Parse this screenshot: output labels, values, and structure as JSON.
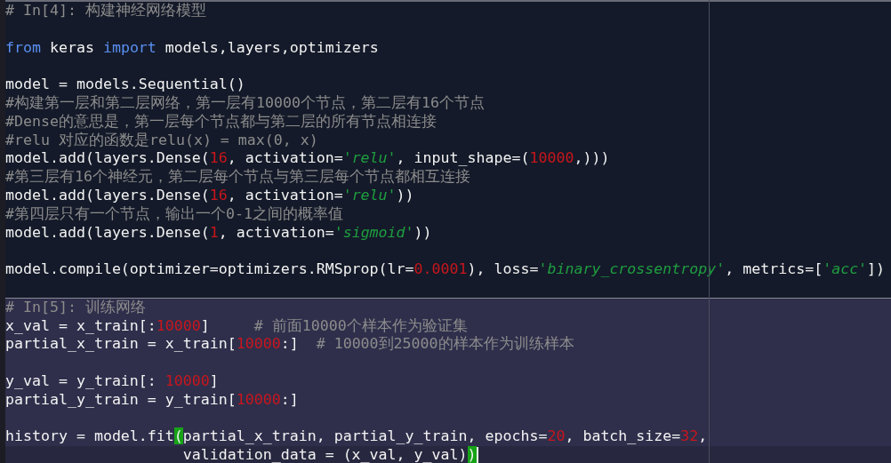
{
  "cells": [
    {
      "selected": false,
      "lines": [
        {
          "current": false,
          "kind": "comment",
          "tokens": [
            {
              "kind": "comment",
              "text": "# In[4]: 构建神经网络模型"
            }
          ]
        },
        {
          "kind": "blank"
        },
        {
          "current": false,
          "kind": "code",
          "tokens": [
            {
              "kind": "keyword",
              "text": "from"
            },
            {
              "kind": "plain",
              "text": " keras "
            },
            {
              "kind": "keyword",
              "text": "import"
            },
            {
              "kind": "plain",
              "text": " models,layers,optimizers"
            }
          ]
        },
        {
          "kind": "blank"
        },
        {
          "current": false,
          "kind": "code",
          "tokens": [
            {
              "kind": "plain",
              "text": "model = models.Sequential()"
            }
          ]
        },
        {
          "current": false,
          "kind": "comment",
          "tokens": [
            {
              "kind": "comment",
              "text": "#构建第一层和第二层网络，第一层有10000个节点，第二层有16个节点"
            }
          ]
        },
        {
          "current": false,
          "kind": "comment",
          "tokens": [
            {
              "kind": "comment",
              "text": "#Dense的意思是，第一层每个节点都与第二层的所有节点相连接"
            }
          ]
        },
        {
          "current": false,
          "kind": "comment",
          "tokens": [
            {
              "kind": "comment",
              "text": "#relu 对应的函数是relu(x) = max(0, x)"
            }
          ]
        },
        {
          "current": false,
          "kind": "code",
          "tokens": [
            {
              "kind": "plain",
              "text": "model.add(layers.Dense("
            },
            {
              "kind": "number",
              "text": "16"
            },
            {
              "kind": "plain",
              "text": ", activation="
            },
            {
              "kind": "string",
              "text": "'relu'"
            },
            {
              "kind": "plain",
              "text": ", input_shape=("
            },
            {
              "kind": "number",
              "text": "10000"
            },
            {
              "kind": "plain",
              "text": ",)))"
            }
          ]
        },
        {
          "current": false,
          "kind": "comment",
          "tokens": [
            {
              "kind": "comment",
              "text": "#第三层有16个神经元，第二层每个节点与第三层每个节点都相互连接"
            }
          ]
        },
        {
          "current": false,
          "kind": "code",
          "tokens": [
            {
              "kind": "plain",
              "text": "model.add(layers.Dense("
            },
            {
              "kind": "number",
              "text": "16"
            },
            {
              "kind": "plain",
              "text": ", activation="
            },
            {
              "kind": "string",
              "text": "'relu'"
            },
            {
              "kind": "plain",
              "text": "))"
            }
          ]
        },
        {
          "current": false,
          "kind": "comment",
          "tokens": [
            {
              "kind": "comment",
              "text": "#第四层只有一个节点，输出一个0-1之间的概率值"
            }
          ]
        },
        {
          "current": false,
          "kind": "code",
          "tokens": [
            {
              "kind": "plain",
              "text": "model.add(layers.Dense("
            },
            {
              "kind": "number",
              "text": "1"
            },
            {
              "kind": "plain",
              "text": ", activation="
            },
            {
              "kind": "string",
              "text": "'sigmoid'"
            },
            {
              "kind": "plain",
              "text": "))"
            }
          ]
        },
        {
          "kind": "blank"
        },
        {
          "current": false,
          "kind": "code",
          "tokens": [
            {
              "kind": "plain",
              "text": "model.compile(optimizer=optimizers.RMSprop(lr="
            },
            {
              "kind": "number",
              "text": "0.0001"
            },
            {
              "kind": "plain",
              "text": "), loss="
            },
            {
              "kind": "string",
              "text": "'binary_crossentropy'"
            },
            {
              "kind": "plain",
              "text": ", metrics=["
            },
            {
              "kind": "string",
              "text": "'acc'"
            },
            {
              "kind": "plain",
              "text": "])"
            }
          ]
        },
        {
          "kind": "blank"
        }
      ]
    },
    {
      "selected": true,
      "lines": [
        {
          "current": false,
          "kind": "comment",
          "tokens": [
            {
              "kind": "comment",
              "text": "# In[5]: 训练网络"
            }
          ]
        },
        {
          "current": false,
          "kind": "code",
          "tokens": [
            {
              "kind": "plain",
              "text": "x_val = x_train[:"
            },
            {
              "kind": "number",
              "text": "10000"
            },
            {
              "kind": "plain",
              "text": "]     "
            },
            {
              "kind": "comment",
              "text": "# 前面10000个样本作为验证集"
            }
          ]
        },
        {
          "current": false,
          "kind": "code",
          "tokens": [
            {
              "kind": "plain",
              "text": "partial_x_train = x_train["
            },
            {
              "kind": "number",
              "text": "10000"
            },
            {
              "kind": "plain",
              "text": ":]  "
            },
            {
              "kind": "comment",
              "text": "# 10000到25000的样本作为训练样本"
            }
          ]
        },
        {
          "kind": "blank"
        },
        {
          "current": false,
          "kind": "code",
          "tokens": [
            {
              "kind": "plain",
              "text": "y_val = y_train[: "
            },
            {
              "kind": "number",
              "text": "10000"
            },
            {
              "kind": "plain",
              "text": "]"
            }
          ]
        },
        {
          "current": false,
          "kind": "code",
          "tokens": [
            {
              "kind": "plain",
              "text": "partial_y_train = y_train["
            },
            {
              "kind": "number",
              "text": "10000"
            },
            {
              "kind": "plain",
              "text": ":]"
            }
          ]
        },
        {
          "kind": "blank"
        },
        {
          "current": false,
          "kind": "code",
          "tokens": [
            {
              "kind": "plain",
              "text": "history = model.fit"
            },
            {
              "kind": "match",
              "text": "("
            },
            {
              "kind": "plain",
              "text": "partial_x_train, partial_y_train, epochs="
            },
            {
              "kind": "number",
              "text": "20"
            },
            {
              "kind": "plain",
              "text": ", batch_size="
            },
            {
              "kind": "number",
              "text": "32"
            },
            {
              "kind": "plain",
              "text": ","
            }
          ]
        },
        {
          "current": true,
          "kind": "code",
          "tokens": [
            {
              "kind": "plain",
              "text": "                    validation_data = (x_val, y_val)"
            },
            {
              "kind": "match",
              "text": ")"
            }
          ]
        }
      ]
    }
  ]
}
